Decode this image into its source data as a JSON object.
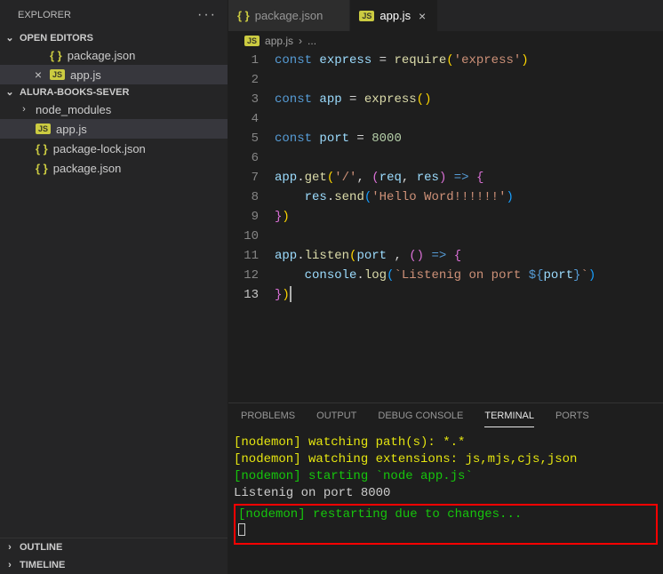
{
  "sidebar": {
    "title": "EXPLORER",
    "sections": {
      "openEditors": {
        "label": "OPEN EDITORS"
      },
      "project": {
        "label": "ALURA-BOOKS-SEVER"
      },
      "outline": {
        "label": "OUTLINE"
      },
      "timeline": {
        "label": "TIMELINE"
      }
    },
    "openEditors": [
      {
        "name": "package.json",
        "icon": "json",
        "active": false,
        "dirty": false
      },
      {
        "name": "app.js",
        "icon": "js",
        "active": true,
        "dirty": false
      }
    ],
    "projectItems": [
      {
        "name": "node_modules",
        "type": "folder"
      },
      {
        "name": "app.js",
        "type": "file",
        "icon": "js",
        "active": true
      },
      {
        "name": "package-lock.json",
        "type": "file",
        "icon": "json"
      },
      {
        "name": "package.json",
        "type": "file",
        "icon": "json"
      }
    ]
  },
  "tabs": [
    {
      "name": "package.json",
      "icon": "json",
      "active": false,
      "dirty": false
    },
    {
      "name": "app.js",
      "icon": "js",
      "active": true,
      "dirty": false
    }
  ],
  "breadcrumb": {
    "icon": "js",
    "file": "app.js",
    "tail": "..."
  },
  "code": {
    "lines": [
      {
        "n": 1,
        "t": [
          [
            "k",
            "const "
          ],
          [
            "v",
            "express"
          ],
          [
            "p",
            " = "
          ],
          [
            "f",
            "require"
          ],
          [
            "br1",
            "("
          ],
          [
            "s",
            "'express'"
          ],
          [
            "br1",
            ")"
          ]
        ]
      },
      {
        "n": 2,
        "t": []
      },
      {
        "n": 3,
        "t": [
          [
            "k",
            "const "
          ],
          [
            "v",
            "app"
          ],
          [
            "p",
            " = "
          ],
          [
            "f",
            "express"
          ],
          [
            "br1",
            "()"
          ]
        ]
      },
      {
        "n": 4,
        "t": []
      },
      {
        "n": 5,
        "t": [
          [
            "k",
            "const "
          ],
          [
            "v",
            "port"
          ],
          [
            "p",
            " = "
          ],
          [
            "n",
            "8000"
          ]
        ]
      },
      {
        "n": 6,
        "t": []
      },
      {
        "n": 7,
        "t": [
          [
            "v",
            "app"
          ],
          [
            "p",
            "."
          ],
          [
            "f",
            "get"
          ],
          [
            "br1",
            "("
          ],
          [
            "s",
            "'/'"
          ],
          [
            "p",
            ", "
          ],
          [
            "br2",
            "("
          ],
          [
            "v",
            "req"
          ],
          [
            "p",
            ", "
          ],
          [
            "v",
            "res"
          ],
          [
            "br2",
            ")"
          ],
          [
            "p",
            " "
          ],
          [
            "k",
            "=>"
          ],
          [
            "p",
            " "
          ],
          [
            "br2",
            "{"
          ]
        ]
      },
      {
        "n": 8,
        "t": [
          [
            "p",
            "    "
          ],
          [
            "v",
            "res"
          ],
          [
            "p",
            "."
          ],
          [
            "f",
            "send"
          ],
          [
            "br3",
            "("
          ],
          [
            "s",
            "'Hello Word!!!!!!'"
          ],
          [
            "br3",
            ")"
          ]
        ]
      },
      {
        "n": 9,
        "t": [
          [
            "br2",
            "}"
          ],
          [
            "br1",
            ")"
          ]
        ]
      },
      {
        "n": 10,
        "t": []
      },
      {
        "n": 11,
        "t": [
          [
            "v",
            "app"
          ],
          [
            "p",
            "."
          ],
          [
            "f",
            "listen"
          ],
          [
            "br1",
            "("
          ],
          [
            "v",
            "port"
          ],
          [
            "p",
            " , "
          ],
          [
            "br2",
            "()"
          ],
          [
            "p",
            " "
          ],
          [
            "k",
            "=>"
          ],
          [
            "p",
            " "
          ],
          [
            "br2",
            "{"
          ]
        ]
      },
      {
        "n": 12,
        "t": [
          [
            "p",
            "    "
          ],
          [
            "v",
            "console"
          ],
          [
            "p",
            "."
          ],
          [
            "f",
            "log"
          ],
          [
            "br3",
            "("
          ],
          [
            "s",
            "`Listenig on port "
          ],
          [
            "k",
            "${"
          ],
          [
            "v",
            "port"
          ],
          [
            "k",
            "}"
          ],
          [
            "s",
            "`"
          ],
          [
            "br3",
            ")"
          ]
        ]
      },
      {
        "n": 13,
        "t": [
          [
            "br2",
            "}"
          ],
          [
            "br1",
            ")"
          ]
        ],
        "cursor": true,
        "hl": true
      }
    ]
  },
  "panel": {
    "tabs": [
      {
        "label": "PROBLEMS"
      },
      {
        "label": "OUTPUT"
      },
      {
        "label": "DEBUG CONSOLE"
      },
      {
        "label": "TERMINAL",
        "active": true
      },
      {
        "label": "PORTS"
      }
    ],
    "terminal": {
      "lines": [
        {
          "cls": "y",
          "text": "[nodemon] watching path(s): *.*"
        },
        {
          "cls": "y",
          "text": "[nodemon] watching extensions: js,mjs,cjs,json"
        },
        {
          "cls": "g",
          "text": "[nodemon] starting `node app.js`"
        },
        {
          "cls": "w",
          "text": "Listenig on port 8000"
        }
      ],
      "highlighted": "[nodemon] restarting due to changes..."
    }
  }
}
